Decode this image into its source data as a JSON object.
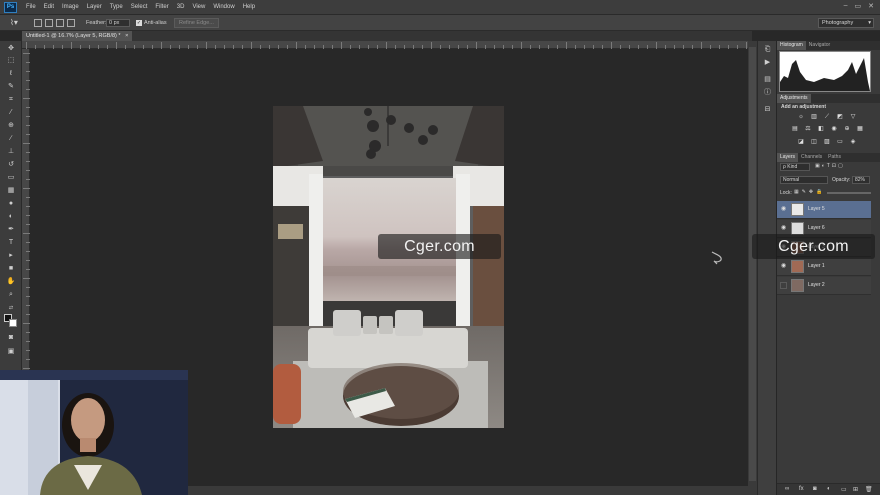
{
  "app": {
    "logo_text": "Ps"
  },
  "menu": [
    "File",
    "Edit",
    "Image",
    "Layer",
    "Type",
    "Select",
    "Filter",
    "3D",
    "View",
    "Window",
    "Help"
  ],
  "window_controls": [
    "–",
    "▭",
    "✕"
  ],
  "options_bar": {
    "feather_label": "Feather:",
    "feather_value": "0 px",
    "anti_alias_label": "Anti-alias",
    "refine_edge_label": "Refine Edge...",
    "workspace": "Photography"
  },
  "document_tab": {
    "title": "Untitled-1 @ 16.7% (Layer 5, RGB/8)",
    "modified": "*"
  },
  "panels": {
    "histogram_tabs": [
      "Histogram",
      "Navigator"
    ],
    "adjustments_tab": "Adjustments",
    "adjustments_heading": "Add an adjustment",
    "layers_tabs": [
      "Layers",
      "Channels",
      "Paths"
    ],
    "kind_filter": "ρ Kind",
    "blend_mode": "Normal",
    "opacity_label": "Opacity:",
    "opacity_value": "82%",
    "lock_label": "Lock:",
    "layers": [
      {
        "name": "Layer 5",
        "selected": true,
        "visible": true
      },
      {
        "name": "Layer 6",
        "selected": false,
        "visible": true
      },
      {
        "name": "Layer 3",
        "selected": false,
        "visible": true
      },
      {
        "name": "Layer 1",
        "selected": false,
        "visible": true
      },
      {
        "name": "Layer 2",
        "selected": false,
        "visible": false
      }
    ]
  },
  "watermarks": [
    "Cger.com",
    "Cger.com"
  ],
  "colors": {
    "accent_selected_layer": "#5a6f92",
    "ps_blue": "#46b4ff"
  }
}
